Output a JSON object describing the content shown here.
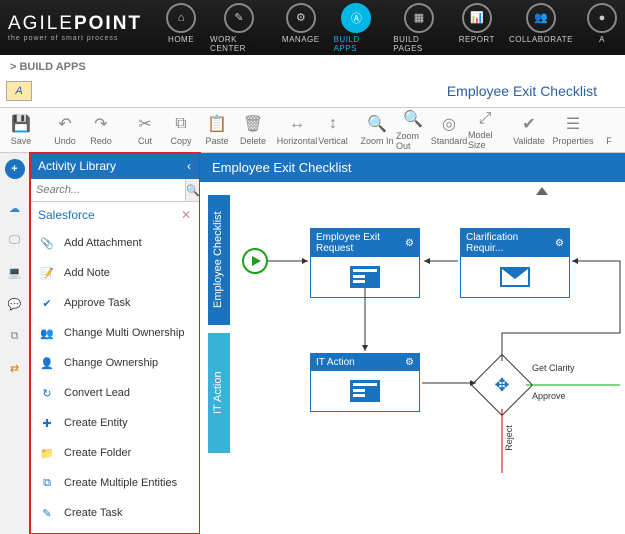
{
  "brand": {
    "name1": "AGILE",
    "name2": "POINT",
    "tag": "the power of smart process"
  },
  "nav": {
    "items": [
      {
        "label": "HOME"
      },
      {
        "label": "WORK CENTER"
      },
      {
        "label": "MANAGE"
      },
      {
        "label": "BUILD APPS",
        "active": true
      },
      {
        "label": "BUILD PAGES"
      },
      {
        "label": "REPORT"
      },
      {
        "label": "COLLABORATE"
      },
      {
        "label": "A"
      }
    ]
  },
  "breadcrumb": "> BUILD APPS",
  "tabchar": "A",
  "page_title": "Employee Exit Checklist",
  "toolbar": [
    {
      "label": "Save",
      "glyph": "💾"
    },
    {
      "sep": true
    },
    {
      "label": "Undo",
      "glyph": "↶"
    },
    {
      "label": "Redo",
      "glyph": "↷"
    },
    {
      "sep": true
    },
    {
      "label": "Cut",
      "glyph": "✂"
    },
    {
      "label": "Copy",
      "glyph": "⧉"
    },
    {
      "label": "Paste",
      "glyph": "📋"
    },
    {
      "label": "Delete",
      "glyph": "🗑"
    },
    {
      "sep": true
    },
    {
      "label": "Horizontal",
      "glyph": "↔"
    },
    {
      "label": "Vertical",
      "glyph": "↕"
    },
    {
      "sep": true
    },
    {
      "label": "Zoom In",
      "glyph": "🔍"
    },
    {
      "label": "Zoom Out",
      "glyph": "🔍"
    },
    {
      "label": "Standard",
      "glyph": "◎"
    },
    {
      "label": "Model Size",
      "glyph": "⤢"
    },
    {
      "sep": true
    },
    {
      "label": "Validate",
      "glyph": "✔"
    },
    {
      "sep": true
    },
    {
      "label": "Properties",
      "glyph": "☰"
    },
    {
      "label": "F",
      "glyph": ""
    }
  ],
  "library": {
    "title": "Activity Library",
    "search_placeholder": "Search...",
    "category": "Salesforce",
    "items": [
      "Add Attachment",
      "Add Note",
      "Approve Task",
      "Change Multi Ownership",
      "Change Ownership",
      "Convert Lead",
      "Create Entity",
      "Create Folder",
      "Create Multiple Entities",
      "Create Task"
    ]
  },
  "lanes": {
    "lane1": "Employee Checklist",
    "lane2": "IT Action"
  },
  "nodes": {
    "exit_request": "Employee Exit Request",
    "clarification": "Clarification Requir...",
    "it_action": "IT Action"
  },
  "edges": {
    "get_clarity": "Get Clarity",
    "approve": "Approve",
    "reject": "Reject"
  }
}
